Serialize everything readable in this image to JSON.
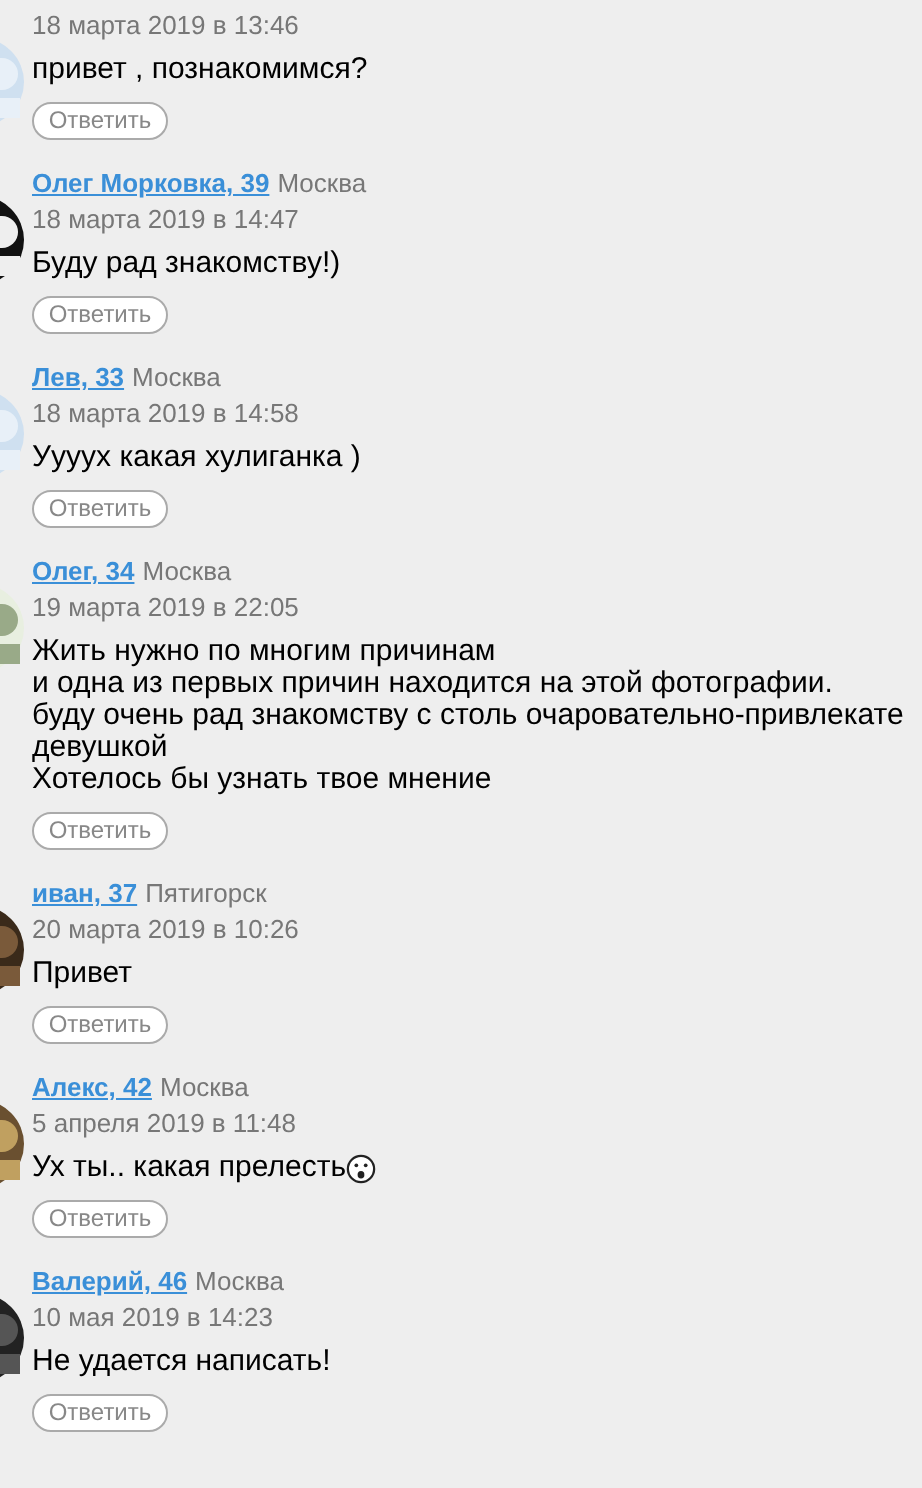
{
  "comments": [
    {
      "date": "18 марта 2019 в 13:46",
      "text": "привет , познакомимся?",
      "kind": "text",
      "reply": "Ответить"
    },
    {
      "author": "Олег Морковка, 39",
      "city": "Москва",
      "date": "18 марта 2019 в 14:47",
      "text": "Буду рад знакомству!)",
      "kind": "text",
      "reply": "Ответить"
    },
    {
      "author": "Лев, 33",
      "city": "Москва",
      "date": "18 марта 2019 в 14:58",
      "text": "Уууух какая хулиганка )",
      "kind": "text",
      "reply": "Ответить"
    },
    {
      "author": "Олег, 34",
      "city": "Москва",
      "date": "19 марта 2019 в 22:05",
      "text": "Жить нужно по многим причинам\nи одна из первых причин находится на этой фотографии.\nбуду очень рад знакомству с столь очаровательно-привлекате\nдевушкой\nХотелось бы узнать твое мнение",
      "kind": "text",
      "reply": "Ответить"
    },
    {
      "author": "иван, 37",
      "city": "Пятигорск",
      "date": "20 марта 2019 в 10:26",
      "text": "Привет",
      "kind": "text",
      "reply": "Ответить"
    },
    {
      "author": "Алекс, 42",
      "city": "Москва",
      "date": "5 апреля 2019 в 11:48",
      "text": "Ух ты.. какая прелесть",
      "kind": "text_emoji",
      "reply": "Ответить"
    },
    {
      "author": "Валерий, 46",
      "city": "Москва",
      "date": "10 мая 2019 в 14:23",
      "text": "Не удается написать!",
      "kind": "text",
      "reply": "Ответить"
    }
  ]
}
